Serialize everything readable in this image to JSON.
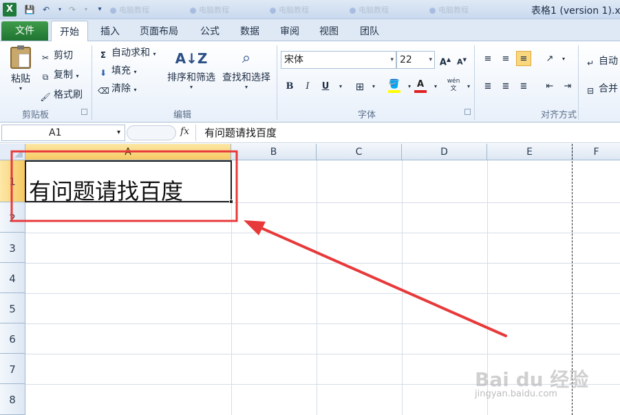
{
  "window": {
    "title": "表格1 (version 1).x",
    "app_icon": "X",
    "background_tab_labels": [
      "电脑教程",
      "电脑教程",
      "电脑教程",
      "电脑教程",
      "电脑教程"
    ]
  },
  "tabs": {
    "file": "文件",
    "items": [
      "开始",
      "插入",
      "页面布局",
      "公式",
      "数据",
      "审阅",
      "视图",
      "团队"
    ],
    "active": "开始"
  },
  "ribbon": {
    "clipboard": {
      "paste": "粘贴",
      "cut": "剪切",
      "copy": "复制",
      "format_painter": "格式刷",
      "label": "剪贴板"
    },
    "editing": {
      "autosum": "自动求和",
      "fill": "填充",
      "clear": "清除",
      "sort_filter": "排序和筛选",
      "find_select": "查找和选择",
      "label": "编辑"
    },
    "font": {
      "name": "宋体",
      "size": "22",
      "label": "字体",
      "bold": "B",
      "italic": "I",
      "underline": "U",
      "phonetic": "wén\n文"
    },
    "alignment": {
      "label": "对齐方式",
      "wrap": "自动",
      "merge": "合并"
    }
  },
  "formula_bar": {
    "name_box": "A1",
    "fx": "fx",
    "value": "有问题请找百度"
  },
  "sheet": {
    "columns": [
      "A",
      "B",
      "C",
      "D",
      "E",
      "F"
    ],
    "rows": [
      "1",
      "2",
      "3",
      "4",
      "5",
      "6",
      "7",
      "8"
    ],
    "selected_column": "A",
    "selected_row": "1",
    "active_cell": "A1",
    "cell_a1": "有问题请找百度"
  },
  "colors": {
    "annotation": "#e8393a",
    "file_tab": "#2e8a3e",
    "selection_header": "#f6c862"
  },
  "watermark": {
    "brand": "Bai du 经验",
    "url": "jingyan.baidu.com"
  }
}
